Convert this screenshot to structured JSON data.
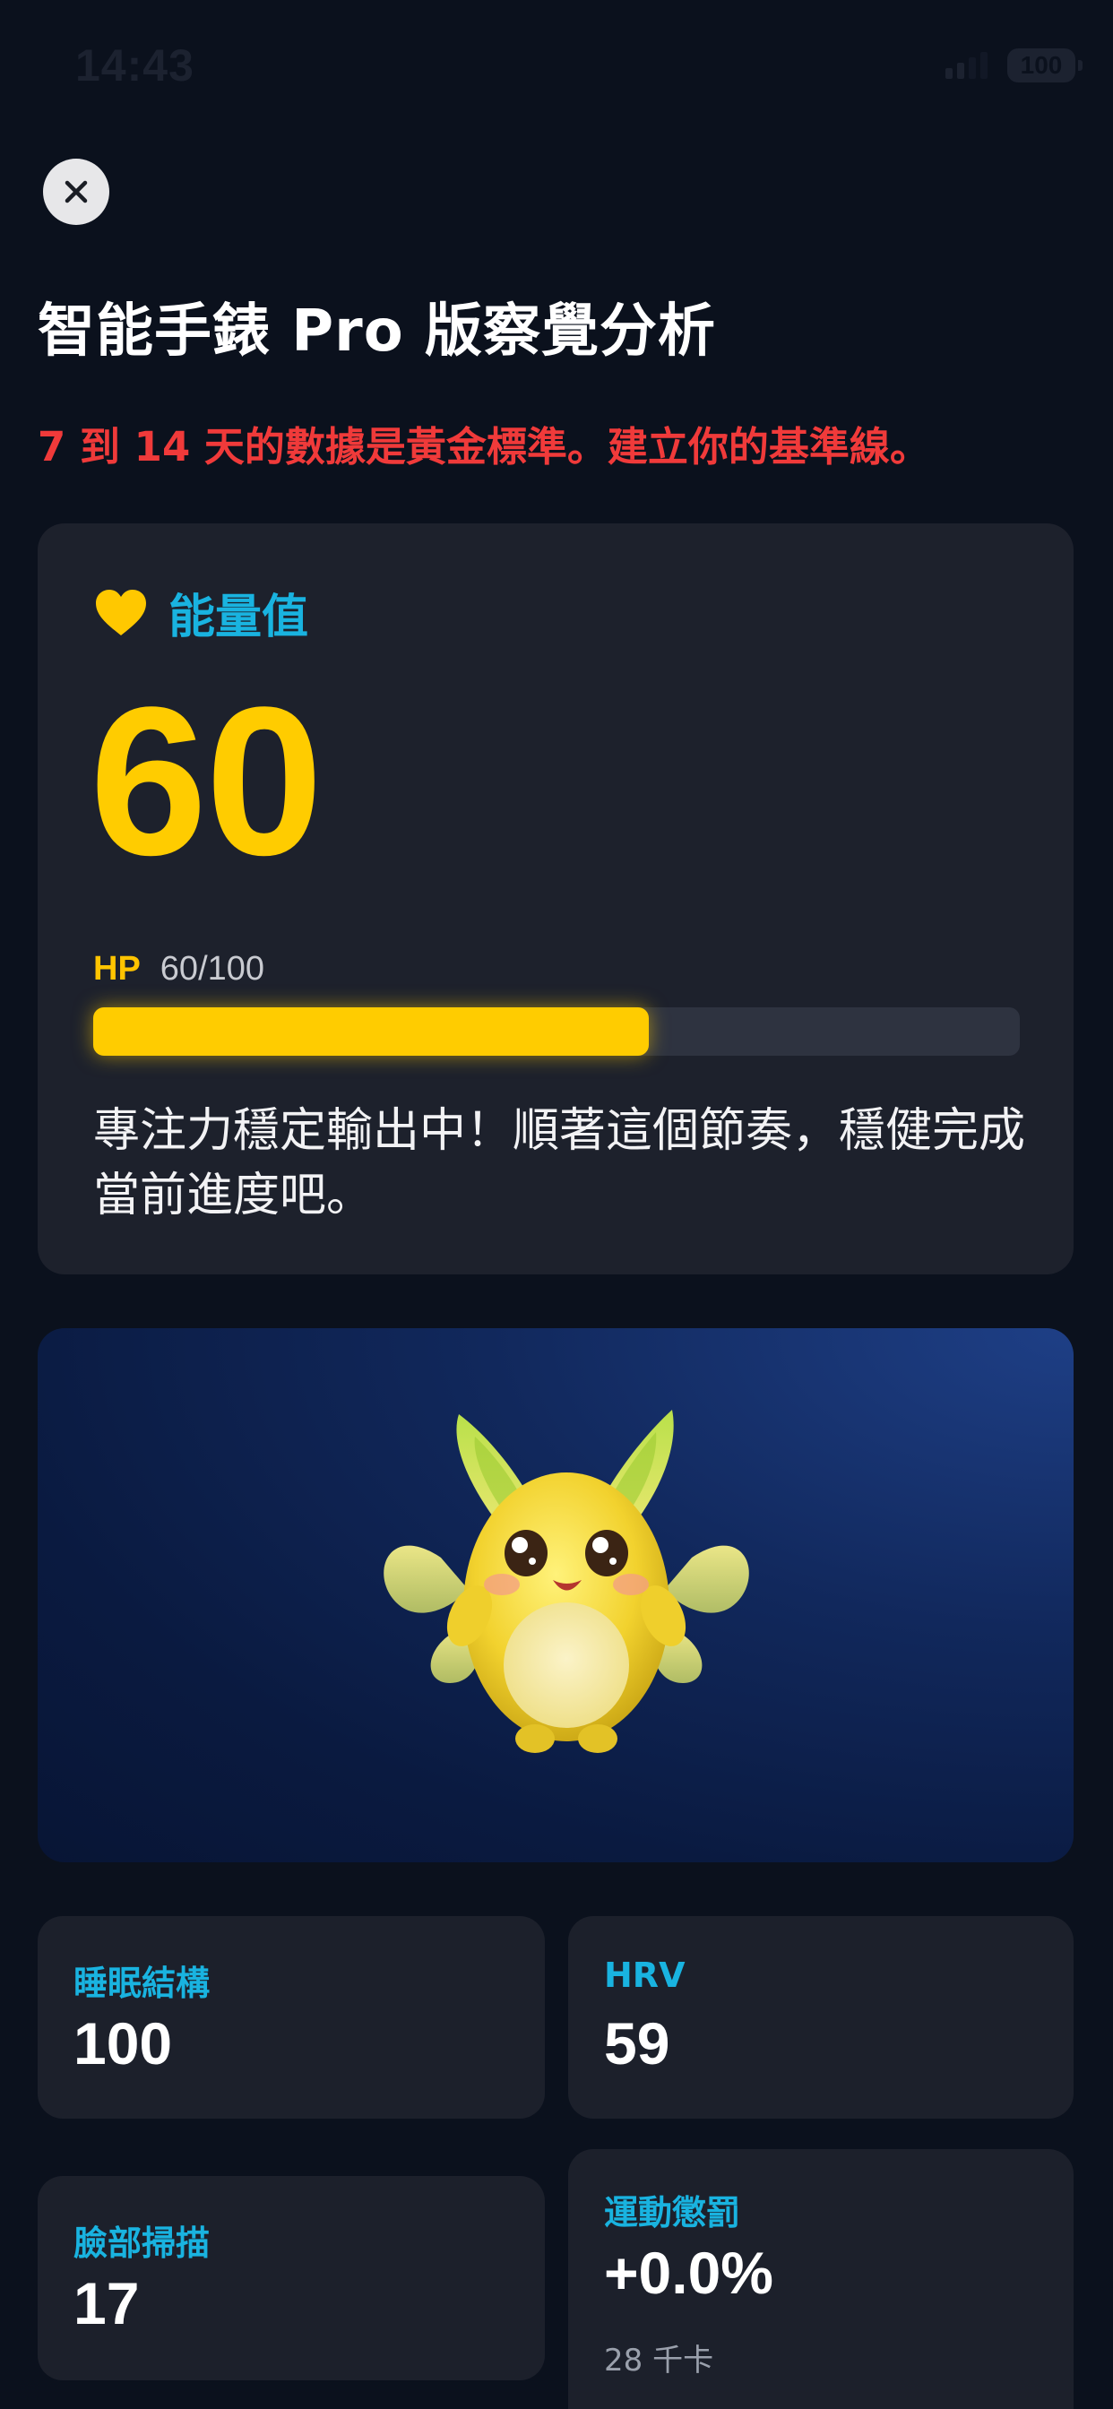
{
  "status_bar": {
    "time": "14:43",
    "battery": "100"
  },
  "page": {
    "title": "智能手錶 Pro 版察覺分析",
    "warning": "7 到 14 天的數據是黃金標準。建立你的基準線。"
  },
  "energy": {
    "icon": "heart-icon",
    "label": "能量值",
    "value": "60",
    "hp_label": "HP",
    "hp_text": "60/100",
    "hp_fraction": 0.6,
    "message": "專注力穩定輸出中！順著這個節奏，穩健完成當前進度吧。"
  },
  "mascot": {
    "icon": "fairy-creature-illustration"
  },
  "stats": [
    {
      "label": "睡眠結構",
      "value": "100"
    },
    {
      "label": "HRV",
      "value": "59"
    },
    {
      "label": "臉部掃描",
      "value": "17"
    },
    {
      "label": "運動懲罰",
      "value": "+0.0%",
      "sub": "28 千卡"
    }
  ],
  "colors": {
    "background": "#0b111d",
    "card": "#1d212c",
    "accent_yellow": "#ffcc00",
    "accent_cyan": "#19b3e0",
    "warning_red": "#f03a3a"
  }
}
